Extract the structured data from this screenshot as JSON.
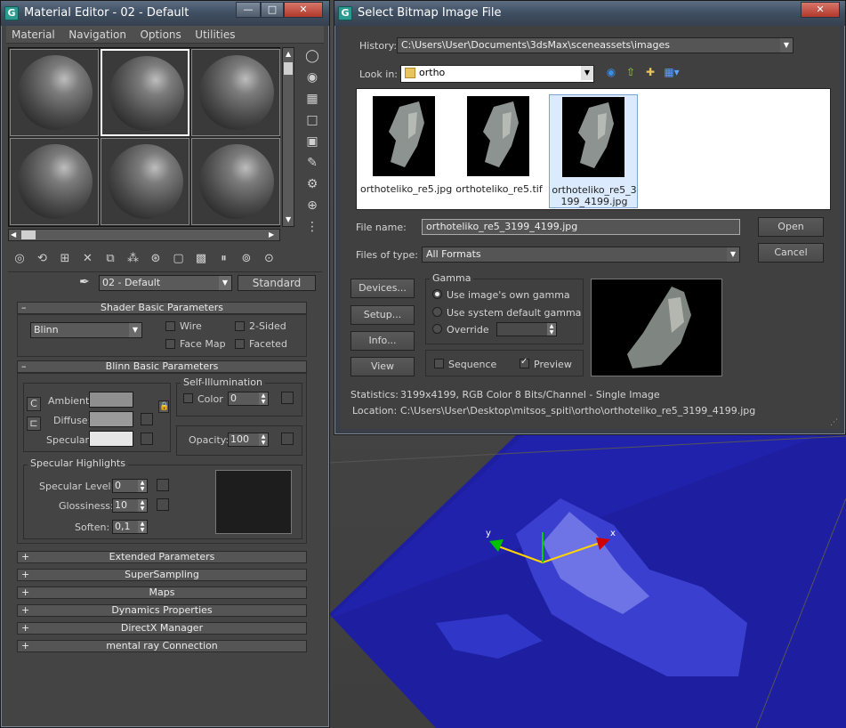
{
  "material_editor": {
    "title": "Material Editor - 02 - Default",
    "menu": [
      "Material",
      "Navigation",
      "Options",
      "Utilities"
    ],
    "material_name": "02 - Default",
    "material_type": "Standard",
    "shader_rollout": {
      "title": "Shader Basic Parameters",
      "shader": "Blinn",
      "wire": "Wire",
      "two_sided": "2-Sided",
      "face_map": "Face Map",
      "faceted": "Faceted"
    },
    "blinn_rollout": {
      "title": "Blinn Basic Parameters",
      "self_illum_title": "Self-Illumination",
      "color_label": "Color",
      "color_value": "0",
      "ambient": "Ambient:",
      "diffuse": "Diffuse:",
      "specular": "Specular:",
      "opacity_label": "Opacity:",
      "opacity_value": "100",
      "lock_c": "C",
      "spec_highlights_title": "Specular Highlights",
      "spec_level_label": "Specular Level:",
      "spec_level_value": "0",
      "glossiness_label": "Glossiness:",
      "glossiness_value": "10",
      "soften_label": "Soften:",
      "soften_value": "0,1"
    },
    "collapsed_rollouts": [
      "Extended Parameters",
      "SuperSampling",
      "Maps",
      "Dynamics Properties",
      "DirectX Manager",
      "mental ray Connection"
    ],
    "colors": {
      "ambient": "#8f8f8f",
      "diffuse": "#9a9a9a",
      "specular": "#e6e6e6"
    }
  },
  "bitmap_dialog": {
    "title": "Select Bitmap Image File",
    "history_label": "History:",
    "history_value": "C:\\Users\\User\\Documents\\3dsMax\\sceneassets\\images",
    "look_in_label": "Look in:",
    "look_in_value": "ortho",
    "files": [
      {
        "name": "orthoteliko_re5.jpg"
      },
      {
        "name": "orthoteliko_re5.tif"
      },
      {
        "name": "orthoteliko_re5_3199_4199.jpg"
      }
    ],
    "file_name_label": "File name:",
    "file_name_value": "orthoteliko_re5_3199_4199.jpg",
    "files_of_type_label": "Files of type:",
    "files_of_type_value": "All Formats",
    "open_button": "Open",
    "cancel_button": "Cancel",
    "devices_button": "Devices...",
    "setup_button": "Setup...",
    "info_button": "Info...",
    "view_button": "View",
    "gamma_title": "Gamma",
    "gamma_options": [
      "Use image's own gamma",
      "Use system default gamma",
      "Override"
    ],
    "sequence_label": "Sequence",
    "preview_label": "Preview",
    "statistics_label": "Statistics:",
    "statistics_value": "3199x4199, RGB Color 8 Bits/Channel - Single Image",
    "location_label": "Location:",
    "location_value": "C:\\Users\\User\\Desktop\\mitsos_spiti\\ortho\\orthoteliko_re5_3199_4199.jpg"
  },
  "viewport": {
    "axis_x": "x",
    "axis_y": "y"
  }
}
